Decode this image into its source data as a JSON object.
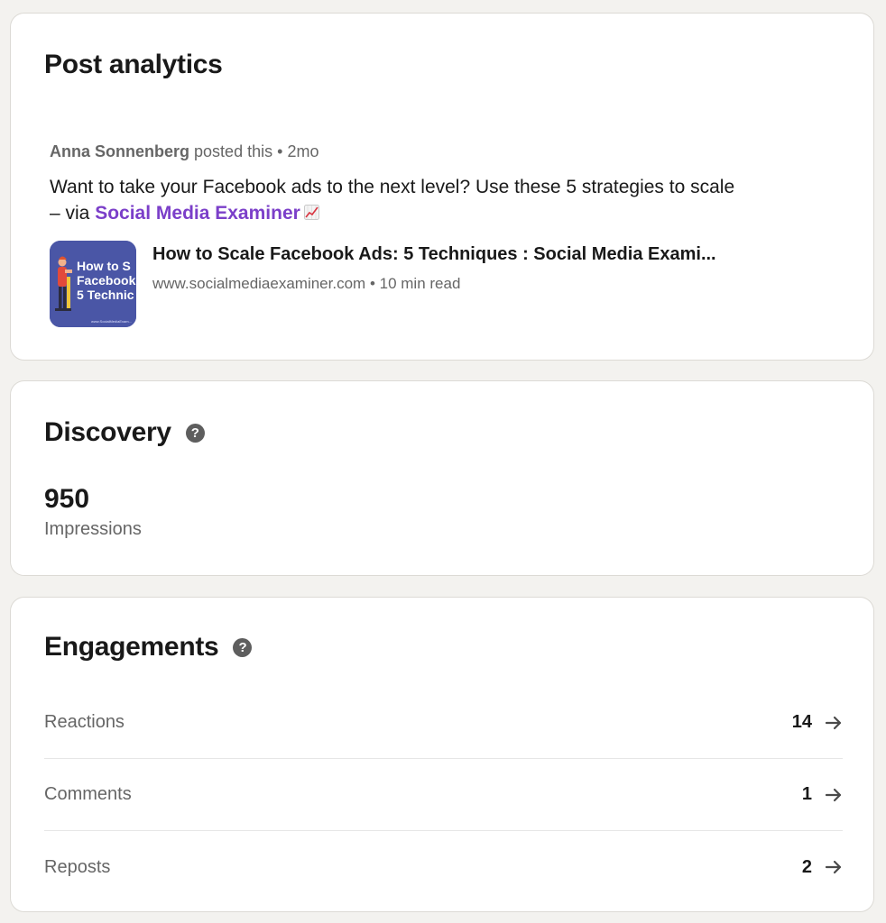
{
  "post_card": {
    "title": "Post analytics",
    "author": "Anna Sonnenberg",
    "posted_text": "posted this",
    "separator": "•",
    "time_ago": "2mo",
    "post_text_before": "Want to take your Facebook ads to the next level? Use these 5 strategies to scale – via ",
    "post_link": "Social Media Examiner",
    "emoji_icon": "chart-increasing-icon",
    "thumbnail": {
      "line1": "How to S",
      "line2": "Facebook",
      "line3": "5 Technic",
      "small": "www.SocialMediaExam...",
      "bg_color": "#4a56a6"
    },
    "article_title": "How to Scale Facebook Ads: 5 Techniques : Social Media Exami...",
    "article_domain": "www.socialmediaexaminer.com",
    "read_time": "10 min read"
  },
  "discovery": {
    "title": "Discovery",
    "help_symbol": "?",
    "impressions_value": "950",
    "impressions_label": "Impressions"
  },
  "engagements": {
    "title": "Engagements",
    "help_symbol": "?",
    "rows": [
      {
        "label": "Reactions",
        "count": "14"
      },
      {
        "label": "Comments",
        "count": "1"
      },
      {
        "label": "Reposts",
        "count": "2"
      }
    ]
  },
  "colors": {
    "page_bg": "#f3f2ef",
    "link_purple": "#7b3fc9",
    "muted_text": "#666666",
    "primary_text": "#191919"
  }
}
